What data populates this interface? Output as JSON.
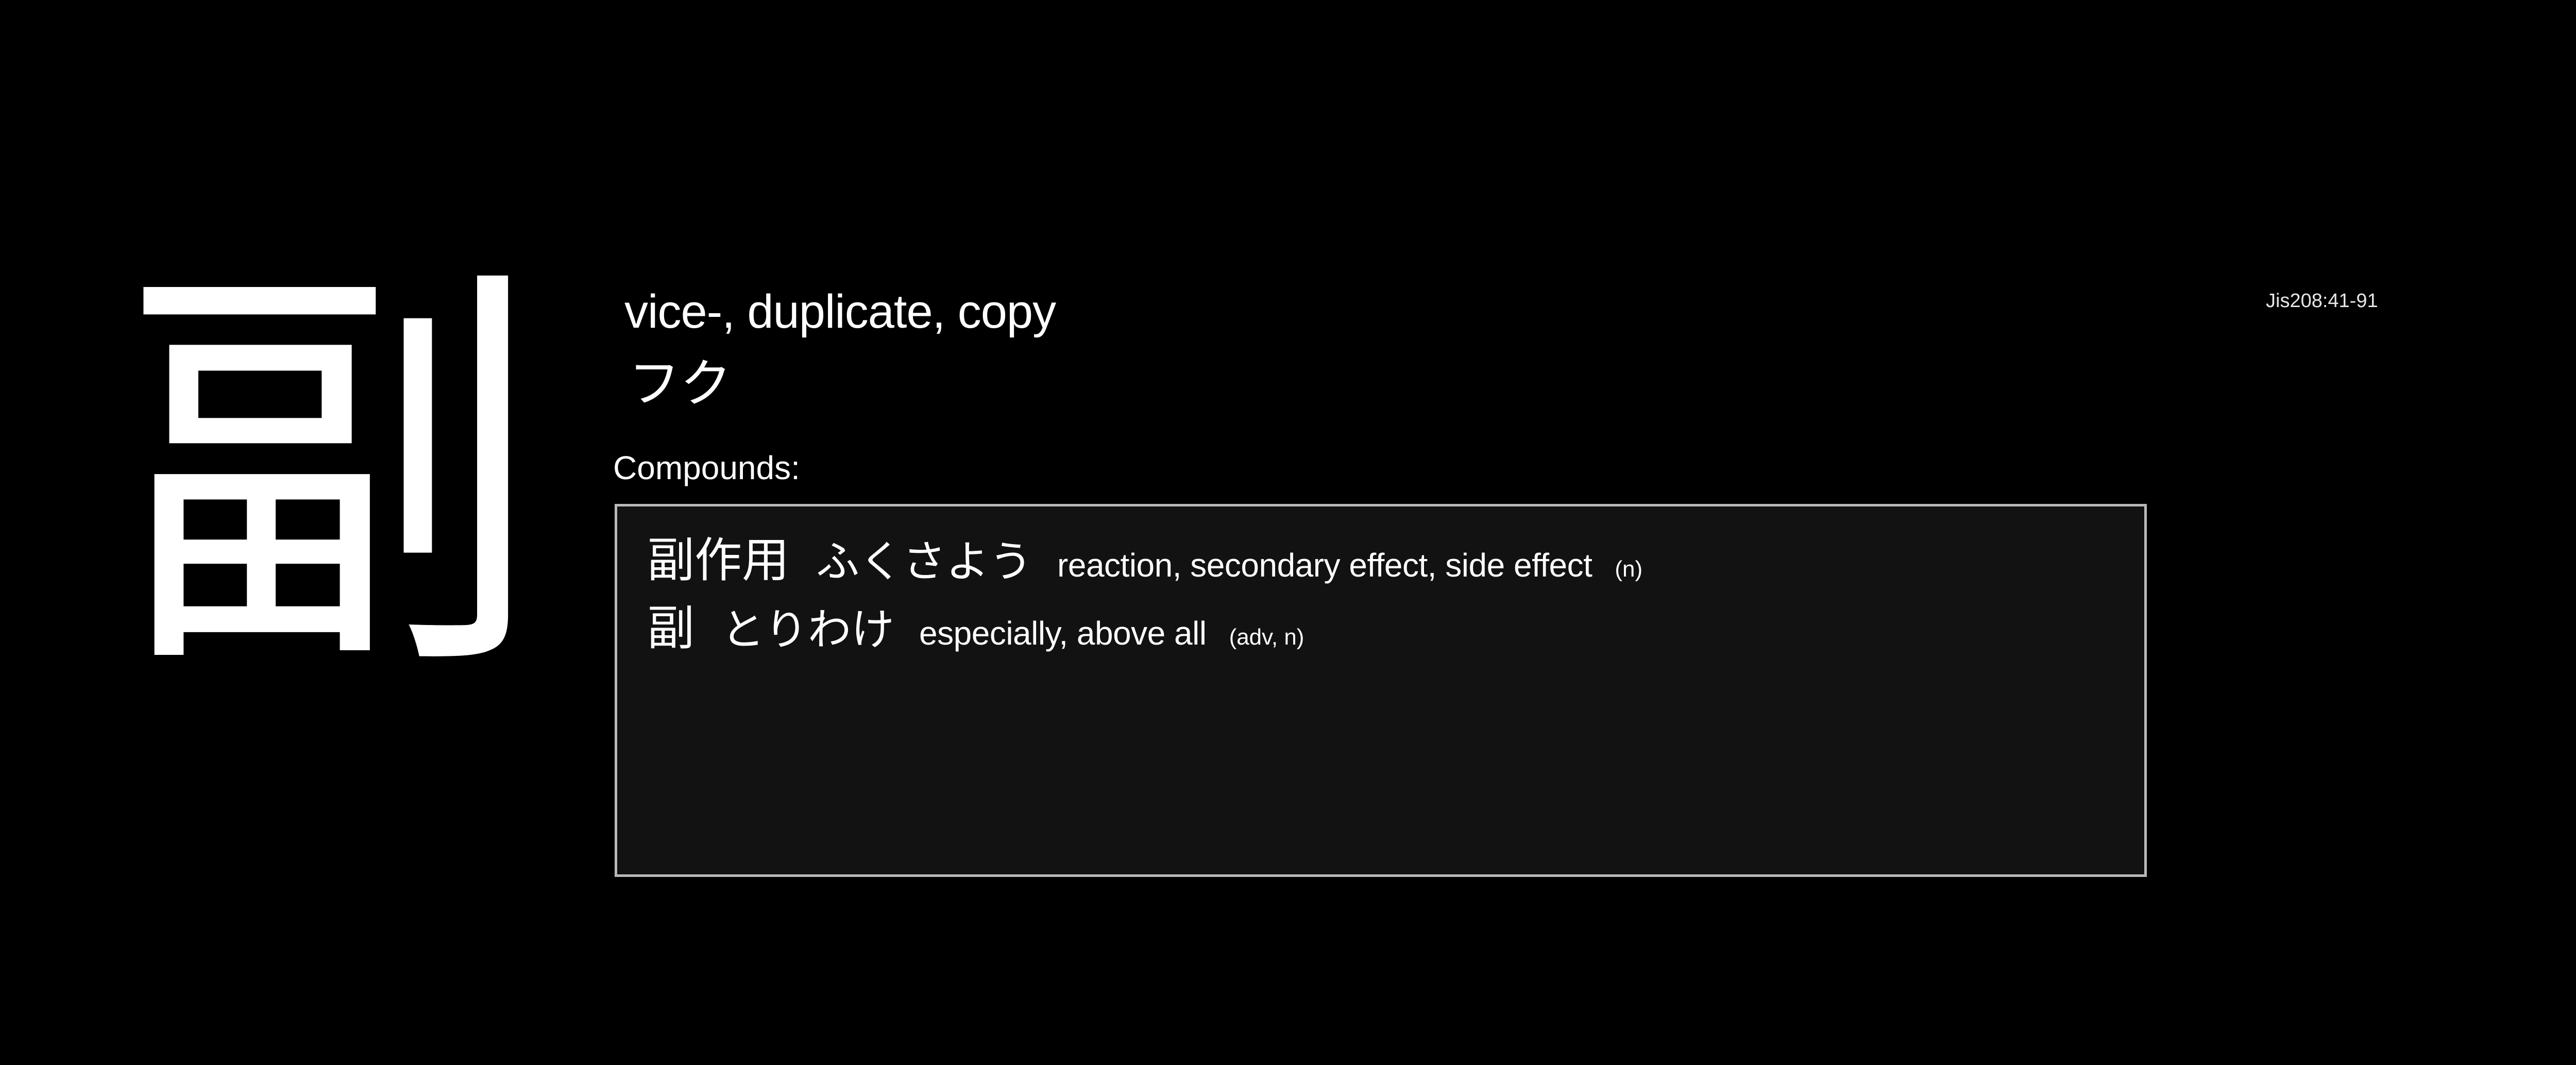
{
  "kanji": {
    "character": "副",
    "meaning": "vice-, duplicate, copy",
    "reading": "フク",
    "jis_code": "Jis208:41-91"
  },
  "compounds": {
    "label": "Compounds:",
    "items": [
      {
        "word": "副作用",
        "reading": "ふくさよう",
        "gloss": "reaction, secondary effect, side effect",
        "pos": "(n)"
      },
      {
        "word": "副",
        "reading": "とりわけ",
        "gloss": "especially, above all",
        "pos": "(adv, n)"
      }
    ]
  },
  "colors": {
    "background": "#000000",
    "text": "#ffffff",
    "box_background": "#121212",
    "box_border": "#b8b8b8"
  }
}
